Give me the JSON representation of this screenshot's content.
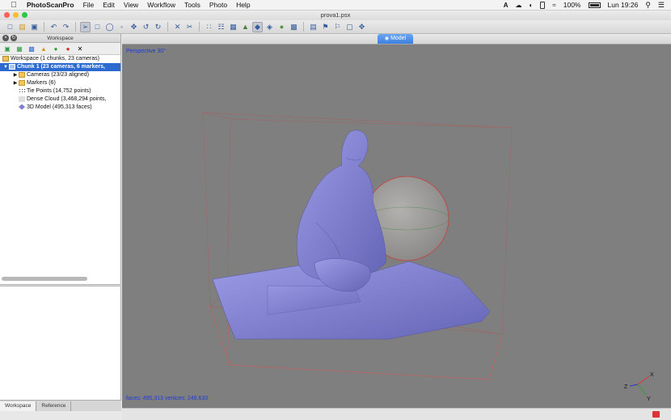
{
  "menubar": {
    "app_name": "PhotoScanPro",
    "items": [
      "File",
      "Edit",
      "View",
      "Workflow",
      "Tools",
      "Photo",
      "Help"
    ],
    "battery": "100%",
    "clock": "Lun 19:26"
  },
  "window": {
    "title": "prova1.psx"
  },
  "workspace_panel": {
    "title": "Workspace",
    "tree": [
      {
        "label": "Workspace (1 chunks, 23 cameras)",
        "level": 0,
        "selected": false,
        "icon": "workspace-icon"
      },
      {
        "label": "Chunk 1 (23 cameras, 6 markers,",
        "level": 0,
        "selected": true,
        "icon": "chunk-icon"
      },
      {
        "label": "Cameras (23/23 aligned)",
        "level": 1,
        "selected": false,
        "icon": "folder-icon"
      },
      {
        "label": "Markers (6)",
        "level": 1,
        "selected": false,
        "icon": "folder-icon"
      },
      {
        "label": "Tie Points (14,752 points)",
        "level": 1,
        "selected": false,
        "icon": "tie-points-icon"
      },
      {
        "label": "Dense Cloud (3,468,294 points,",
        "level": 1,
        "selected": false,
        "icon": "dense-cloud-icon"
      },
      {
        "label": "3D Model (495,313 faces)",
        "level": 1,
        "selected": false,
        "icon": "model-icon"
      }
    ],
    "tabs": [
      "Workspace",
      "Reference"
    ]
  },
  "view": {
    "tab_label": "Model",
    "projection_label": "Perspective 30°",
    "stats_label": "faces: 495,313 vertices: 246,633"
  },
  "axes": {
    "x": "X",
    "y": "Y",
    "z": "Z"
  }
}
